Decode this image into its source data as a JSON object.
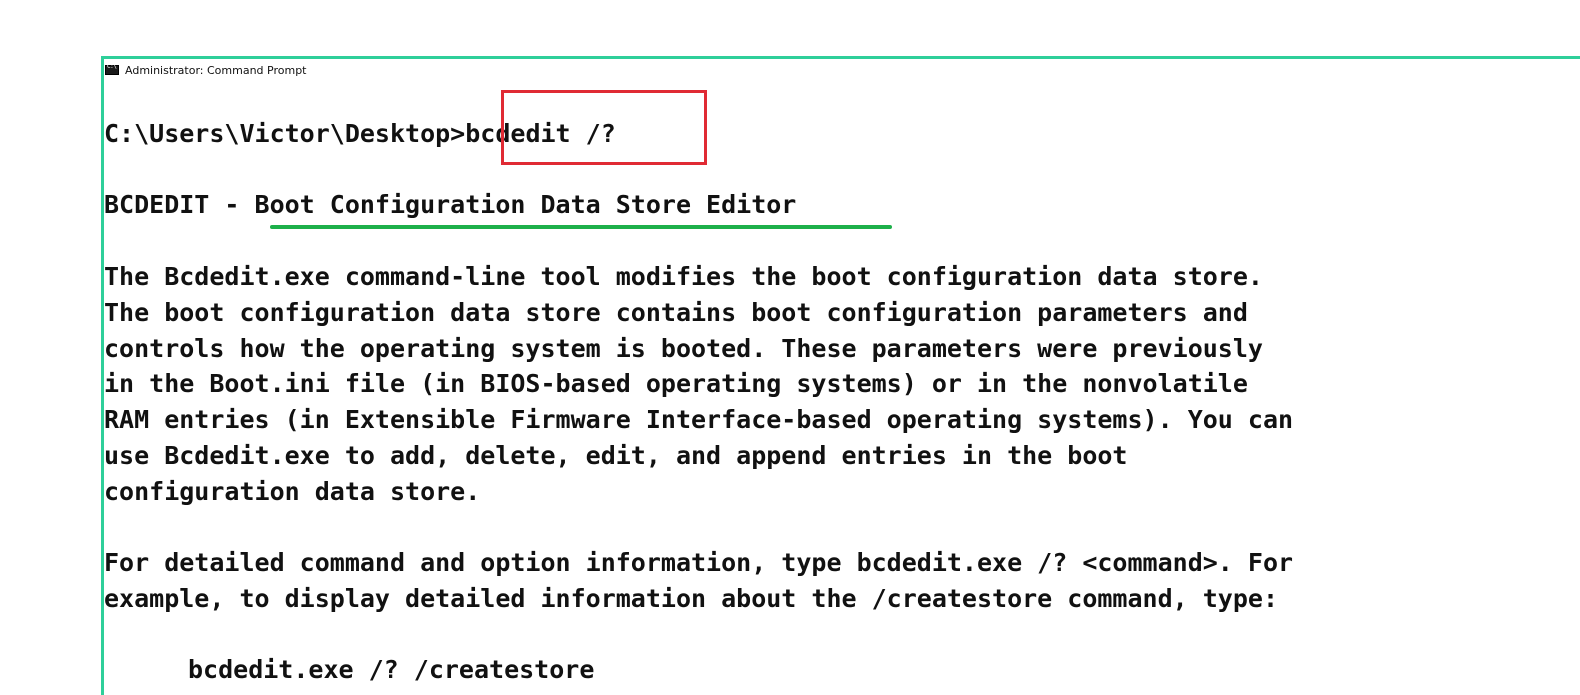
{
  "window": {
    "title": "Administrator: Command Prompt"
  },
  "console": {
    "prompt": "C:\\Users\\Victor\\Desktop>",
    "command": "bcdedit /?",
    "header_prefix": "BCDEDIT - ",
    "header_title": "Boot Configuration Data Store Editor",
    "description": [
      "The Bcdedit.exe command-line tool modifies the boot configuration data store.",
      "The boot configuration data store contains boot configuration parameters and",
      "controls how the operating system is booted. These parameters were previously",
      "in the Boot.ini file (in BIOS-based operating systems) or in the nonvolatile",
      "RAM entries (in Extensible Firmware Interface-based operating systems). You can",
      "use Bcdedit.exe to add, delete, edit, and append entries in the boot",
      "configuration data store."
    ],
    "help": [
      "For detailed command and option information, type bcdedit.exe /? <command>. For",
      "example, to display detailed information about the /createstore command, type:"
    ],
    "example": "bcdedit.exe /? /createstore"
  },
  "annotations": {
    "command_box_color": "#e02a34",
    "title_underline_color": "#1db04a",
    "window_border_color": "#2ecf9a"
  }
}
